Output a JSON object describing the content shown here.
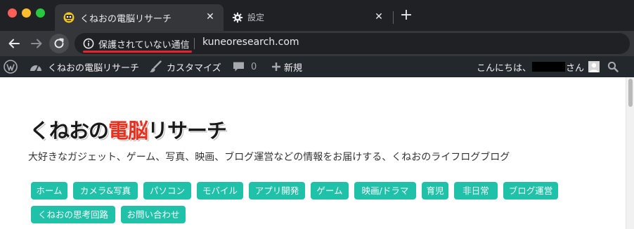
{
  "browser": {
    "tabs": [
      {
        "title": "くねおの電脳リサーチ",
        "active": true,
        "favicon": "rocket-face-favicon"
      },
      {
        "title": "設定",
        "active": false,
        "favicon": "gear-icon"
      }
    ],
    "close_glyph": "✕",
    "new_tab_glyph": "+",
    "security_label": "保護されていない通信",
    "url": "kuneoresearch.com",
    "colors": {
      "tabstrip": "#202124",
      "toolbar": "#35363a",
      "omnibox": "#202124",
      "underline": "#e8232e"
    }
  },
  "adminbar": {
    "site_name": "くねおの電脳リサーチ",
    "customize": "カスタマイズ",
    "comments_count": "0",
    "new_label": "新規",
    "greeting_prefix": "こんにちは、",
    "greeting_suffix": "さん",
    "icons": [
      "wordpress-logo-icon",
      "dashboard-icon",
      "brush-icon",
      "comment-icon",
      "plus-icon",
      "avatar",
      "search-icon"
    ]
  },
  "site": {
    "logo_before": "くねおの",
    "logo_accent": "電脳",
    "logo_after": "リサーチ",
    "tagline": "大好きなガジェット、ゲーム、写真、映画、ブログ運営などの情報をお届けする、くねおのライフログブログ",
    "accent_color": "#e8321f",
    "nav_color": "#1fc2a8",
    "nav_items": [
      "ホーム",
      "カメラ&写真",
      "パソコン",
      "モバイル",
      "アプリ開発",
      "ゲーム",
      "映画/ドラマ",
      "育児",
      "非日常",
      "ブログ運営",
      "くねおの思考回路",
      "お問い合わせ"
    ]
  }
}
